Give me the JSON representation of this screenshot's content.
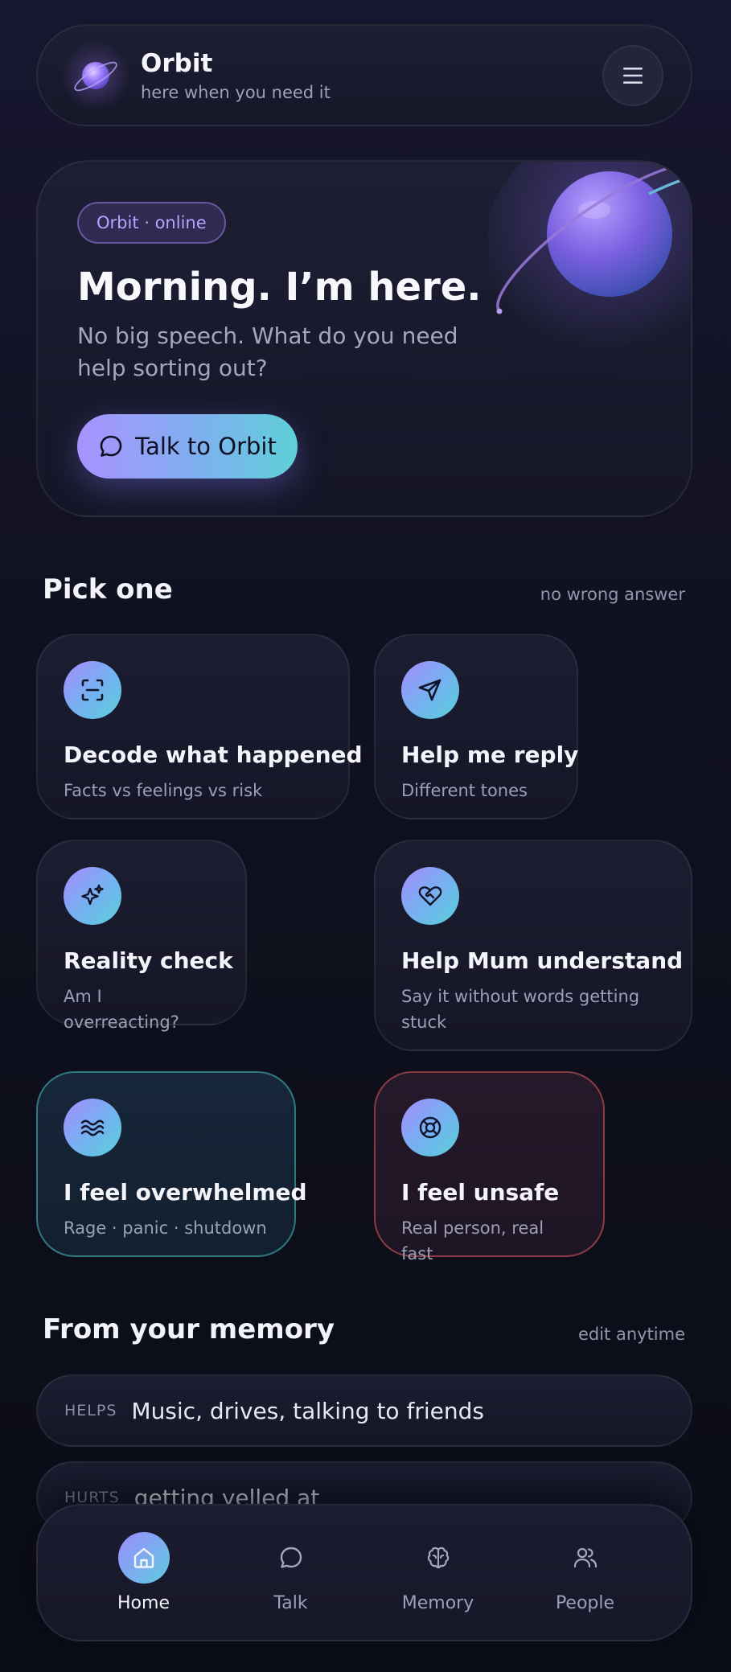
{
  "app": {
    "name": "Orbit",
    "tagline": "here when you need it"
  },
  "hero": {
    "status": "Orbit · online",
    "title": "Morning. I’m here.",
    "subtitle": "No big speech. What do you need help sorting out?",
    "cta": "Talk to Orbit"
  },
  "pick": {
    "title": "Pick one",
    "note": "no wrong answer",
    "options": [
      {
        "title": "Decode what happened",
        "desc": "Facts vs feelings vs risk",
        "icon": "scan-icon"
      },
      {
        "title": "Help me reply",
        "desc": "Different tones",
        "icon": "send-icon"
      },
      {
        "title": "Reality check",
        "desc": "Am I overreacting?",
        "icon": "sparkles-icon"
      },
      {
        "title": "Help Mum understand",
        "desc": "Say it without words getting stuck",
        "icon": "heart-handshake-icon"
      },
      {
        "title": "I feel overwhelmed",
        "desc": "Rage · panic · shutdown",
        "icon": "waves-icon"
      },
      {
        "title": "I feel unsafe",
        "desc": "Real person, real fast",
        "icon": "lifebuoy-icon"
      }
    ]
  },
  "memory": {
    "title": "From your memory",
    "note": "edit anytime",
    "items": [
      {
        "key": "HELPS",
        "value": "Music, drives, talking to friends"
      },
      {
        "key": "HURTS",
        "value": "getting yelled at"
      }
    ]
  },
  "nav": {
    "items": [
      {
        "label": "Home",
        "icon": "home-icon",
        "active": true
      },
      {
        "label": "Talk",
        "icon": "chat-icon"
      },
      {
        "label": "Memory",
        "icon": "brain-icon"
      },
      {
        "label": "People",
        "icon": "people-icon"
      }
    ]
  },
  "colors": {
    "accent_start": "#a992ff",
    "accent_end": "#5ed0d8",
    "calm_border": "#2f7a80",
    "danger_border": "#8a3c42"
  }
}
